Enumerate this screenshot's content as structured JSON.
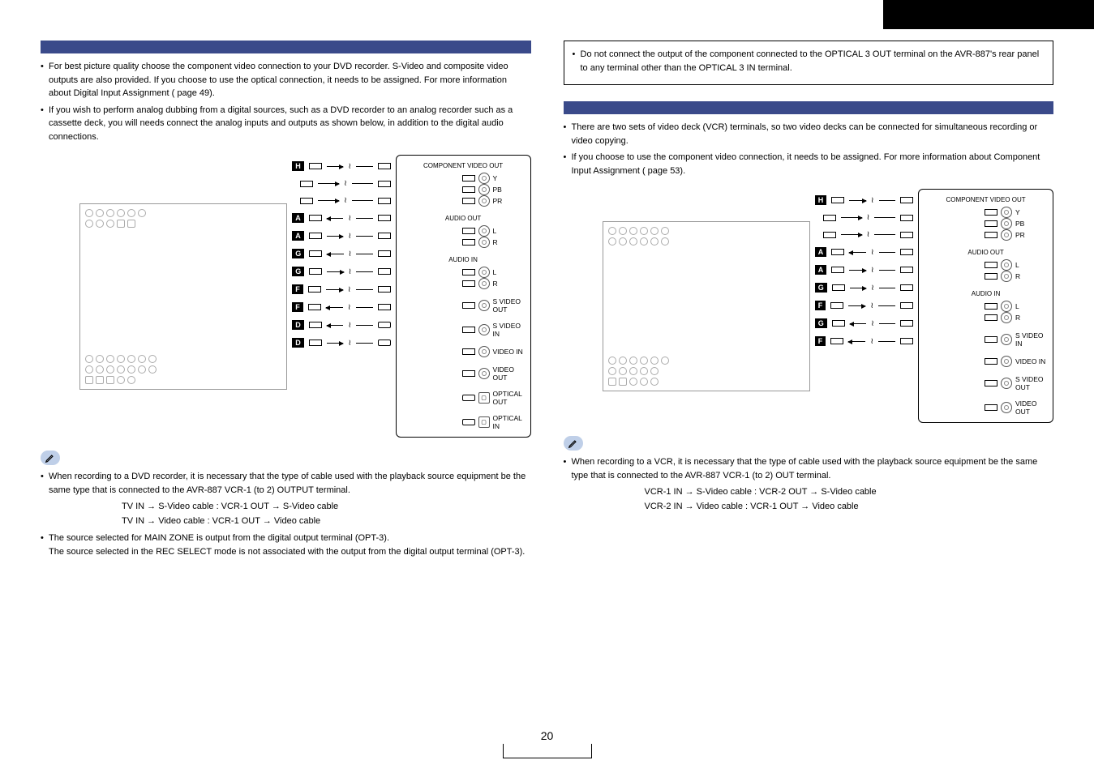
{
  "left": {
    "bullets": [
      "For best picture quality choose the component video connection to your DVD recorder. S-Video and composite video outputs are also provided. If you choose to use the optical connection, it needs to be assigned. For more information about Digital Input Assignment ( page 49).",
      "If you wish to perform analog dubbing from a digital sources, such as a DVD recorder to an analog recorder such as a cassette deck, you will needs connect the analog inputs and outputs as shown below, in addition to the digital audio connections."
    ],
    "terminal": {
      "comp_title": "COMPONENT VIDEO OUT",
      "comp_labels": [
        "Y",
        "PB",
        "PR"
      ],
      "audio_out": "AUDIO OUT",
      "audio_in": "AUDIO IN",
      "lr": [
        "L",
        "R"
      ],
      "svideo_out": "S VIDEO OUT",
      "svideo_in": "S VIDEO IN",
      "video_in": "VIDEO IN",
      "video_out": "VIDEO OUT",
      "opt_out": "OPTICAL OUT",
      "opt_in": "OPTICAL IN"
    },
    "cable_tags_seq": [
      "H",
      "A",
      "A",
      "G",
      "G",
      "F",
      "F",
      "D",
      "D"
    ],
    "note_lead": "When recording to a DVD recorder, it is necessary that the type of cable used with the playback source equipment be the same type that is connected to the AVR-887 VCR-1 (to 2) OUTPUT terminal.",
    "example1": "TV IN → S-Video cable : VCR-1 OUT → S-Video cable",
    "example2": "TV IN → Video cable : VCR-1 OUT → Video cable",
    "note2a": "The source selected for MAIN ZONE is output from the digital output terminal (OPT-3).",
    "note2b": "The source selected in the REC SELECT mode is not associated with the output from the digital output terminal (OPT-3)."
  },
  "right": {
    "caution": "Do not connect the output of the component connected to the OPTICAL 3 OUT terminal on the AVR-887's rear panel to any terminal other than the OPTICAL 3 IN terminal.",
    "bullets": [
      "There are two sets of video deck (VCR) terminals, so two video decks can be connected for simultaneous recording or video copying.",
      "If you choose to use the component video connection, it needs to be assigned. For more information about Component Input Assignment ( page 53)."
    ],
    "terminal": {
      "comp_title": "COMPONENT VIDEO OUT",
      "comp_labels": [
        "Y",
        "PB",
        "PR"
      ],
      "audio_out": "AUDIO OUT",
      "audio_in": "AUDIO IN",
      "lr": [
        "L",
        "R"
      ],
      "svideo_in": "S VIDEO IN",
      "video_in": "VIDEO IN",
      "svideo_out": "S VIDEO OUT",
      "video_out": "VIDEO OUT"
    },
    "cable_tags_seq": [
      "H",
      "A",
      "A",
      "G",
      "F",
      "G",
      "F"
    ],
    "note_lead": "When recording to a VCR, it is necessary that the type of cable used with the playback source equipment be the same type that is connected to the AVR-887 VCR-1 (to 2) OUT terminal.",
    "example1": "VCR-1 IN → S-Video cable : VCR-2 OUT → S-Video cable",
    "example2": "VCR-2 IN → Video cable : VCR-1 OUT → Video cable"
  },
  "page_number": "20"
}
